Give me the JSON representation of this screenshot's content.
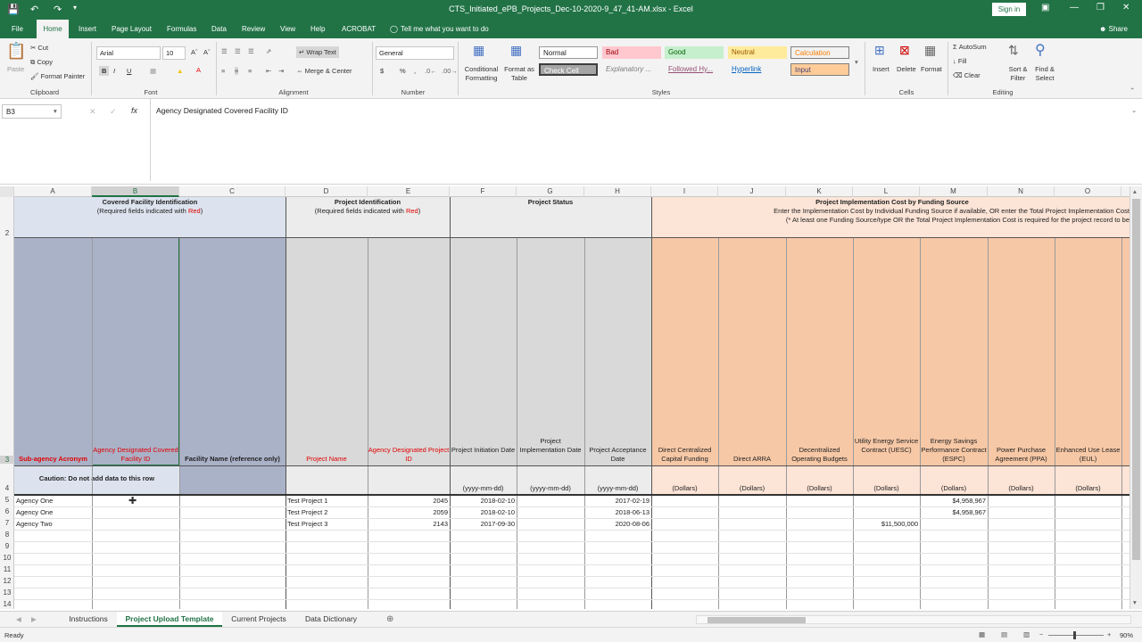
{
  "titlebar": {
    "title": "CTS_Initiated_ePB_Projects_Dec-10-2020-9_47_41-AM.xlsx  -  Excel",
    "signin": "Sign in"
  },
  "menu": {
    "tabs": [
      "File",
      "Home",
      "Insert",
      "Page Layout",
      "Formulas",
      "Data",
      "Review",
      "View",
      "Help",
      "ACROBAT"
    ],
    "tell_me": "Tell me what you want to do",
    "share": "Share"
  },
  "ribbon": {
    "clipboard": {
      "paste": "Paste",
      "cut": "Cut",
      "copy": "Copy",
      "format_painter": "Format Painter",
      "label": "Clipboard"
    },
    "font": {
      "name": "Arial",
      "size": "10",
      "label": "Font"
    },
    "alignment": {
      "wrap": "Wrap Text",
      "merge": "Merge & Center",
      "label": "Alignment"
    },
    "number": {
      "format": "General",
      "label": "Number"
    },
    "styles": {
      "cond": "Conditional Formatting",
      "table": "Format as Table",
      "label": "Styles",
      "cells": [
        "Normal",
        "Bad",
        "Good",
        "Neutral",
        "Calculation",
        "Check Cell",
        "Explanatory ...",
        "Followed Hy...",
        "Hyperlink",
        "Input"
      ]
    },
    "cells": {
      "insert": "Insert",
      "delete": "Delete",
      "format": "Format",
      "label": "Cells"
    },
    "editing": {
      "autosum": "AutoSum",
      "fill": "Fill",
      "clear": "Clear",
      "sort": "Sort & Filter",
      "find": "Find & Select",
      "label": "Editing"
    }
  },
  "formula_bar": {
    "name_box": "B3",
    "content": "Agency Designated Covered Facility ID"
  },
  "columns": [
    "A",
    "B",
    "C",
    "D",
    "E",
    "F",
    "G",
    "H",
    "I",
    "J",
    "K",
    "L",
    "M",
    "N",
    "O"
  ],
  "rows": [
    "2",
    "3",
    "4",
    "5",
    "6",
    "7",
    "8",
    "9",
    "10",
    "11",
    "12",
    "13",
    "14"
  ],
  "groups": {
    "facility": {
      "title": "Covered Facility Identification",
      "note_pre": "(Required fields indicated with ",
      "note_red": "Red",
      "note_post": ")"
    },
    "project": {
      "title": "Project Identification",
      "note_pre": "(Required fields indicated with ",
      "note_red": "Red",
      "note_post": ")"
    },
    "status": {
      "title": "Project Status"
    },
    "cost": {
      "title": "Project Implementation Cost by Funding Source",
      "line1": "Enter the Implementation Cost by Individual Funding Source if available, OR enter the Total Project Implementation Cost",
      "line2": "(* At least one Funding Source/type OR the Total Project Implementation Cost is required for the project record to be"
    }
  },
  "headers": [
    "Sub-agency Acronym",
    "Agency Designated Covered Facility ID",
    "Facility Name (reference only)",
    "Project Name",
    "Agency Designated Project ID",
    "Project Initiation Date",
    "Project Implementation Date",
    "Project Acceptance Date",
    "Direct Centralized Capital Funding",
    "Direct ARRA",
    "Decentralized Operating Budgets",
    "Utility Energy Service Contract (UESC)",
    "Energy Savings Performance Contract (ESPC)",
    "Power Purchase Agreement (PPA)",
    "Enhanced Use Lease (EUL)"
  ],
  "units_row": {
    "caution": "Caution: Do not add data to this row",
    "date": "(yyyy-mm-dd)",
    "dollars": "(Dollars)"
  },
  "data_rows": [
    {
      "a": "Agency One",
      "d": "Test Project 1",
      "e": "2045",
      "f": "2018-02-10",
      "g": "",
      "h": "2017-02-19",
      "l": "",
      "m": "$4,958,967"
    },
    {
      "a": "Agency One",
      "d": "Test Project 2",
      "e": "2059",
      "f": "2018-02-10",
      "g": "",
      "h": "2018-06-13",
      "l": "",
      "m": "$4,958,967"
    },
    {
      "a": "Agency Two",
      "d": "Test Project 3",
      "e": "2143",
      "f": "2017-09-30",
      "g": "",
      "h": "2020-08-06",
      "l": "$11,500,000",
      "m": ""
    }
  ],
  "sheet_tabs": [
    "Instructions",
    "Project Upload Template",
    "Current Projects",
    "Data Dictionary"
  ],
  "status": {
    "ready": "Ready",
    "zoom": "90%"
  },
  "colors": {
    "excel_green": "#217346",
    "blue_header": "#aab2c8",
    "gray_header": "#d9d9d9",
    "orange_header": "#f7c8a6",
    "light_blue_group": "#dce3ee",
    "light_orange_group": "#fce4d6",
    "required_red": "#e00000"
  }
}
